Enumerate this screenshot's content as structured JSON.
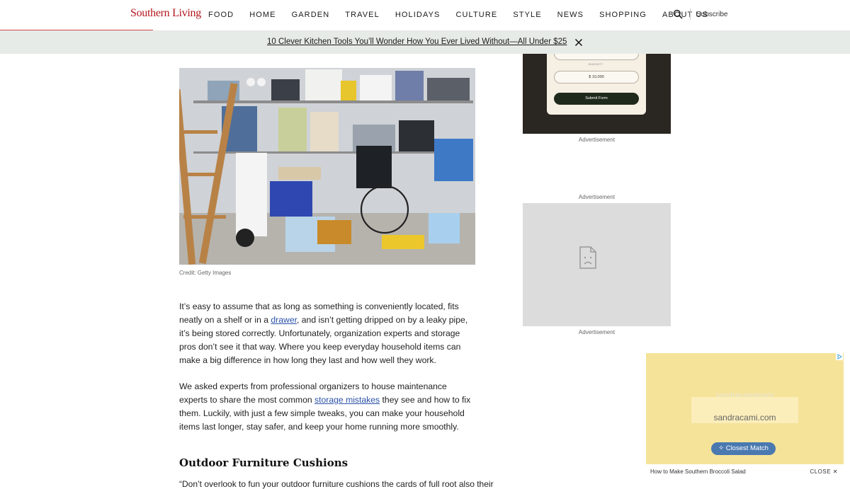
{
  "header": {
    "logo": "Southern Living",
    "nav": [
      "FOOD",
      "HOME",
      "GARDEN",
      "TRAVEL",
      "HOLIDAYS",
      "CULTURE",
      "STYLE",
      "NEWS",
      "SHOPPING",
      "ABOUT US"
    ],
    "subscribe": "Subscribe",
    "search_icon": "search-icon",
    "accent_color": "#b5191f"
  },
  "promo": {
    "link": "10 Clever Kitchen Tools You’ll Wonder How You Ever Lived Without—All Under $25",
    "close_icon": "close-icon"
  },
  "article": {
    "photo_credit": "Credit: Getty Images",
    "p1": {
      "before": "It’s easy to assume that as long as something is conveniently located, fits neatly on a shelf or in a ",
      "link": "drawer",
      "after": ", and isn’t getting dripped on by a leaky pipe, it’s being stored correctly. Unfortunately, organization experts and storage pros don’t see it that way. Where you keep everyday household items can make a big difference in how long they last and how well they work."
    },
    "p2": {
      "before": "We asked experts from professional organizers to house maintenance experts to share the most common ",
      "link": "storage mistakes",
      "after": " they see and how to fix them. Luckily, with just a few simple tweaks, you can make your household items last longer, stay safer, and keep your home running more smoothly."
    },
    "subhead": "Outdoor Furniture Cushions",
    "cut_text": "“Don’t overlook to fun your outdoor furniture cushions the cards of full root also their"
  },
  "ads": {
    "label": "Advertisement",
    "form_budget_label": "BUDGET*",
    "form_budget_value": "$ 10,000",
    "form_submit": "Submit Form",
    "broken_icon": "broken-image-icon"
  },
  "video_ad": {
    "faded": "sandracamimoor",
    "domain": "sandracami.com",
    "button": "Closest Match",
    "footer_title": "How to Make Southern Broccoli Salad",
    "close": "CLOSE",
    "button_color": "#4a79b0"
  }
}
